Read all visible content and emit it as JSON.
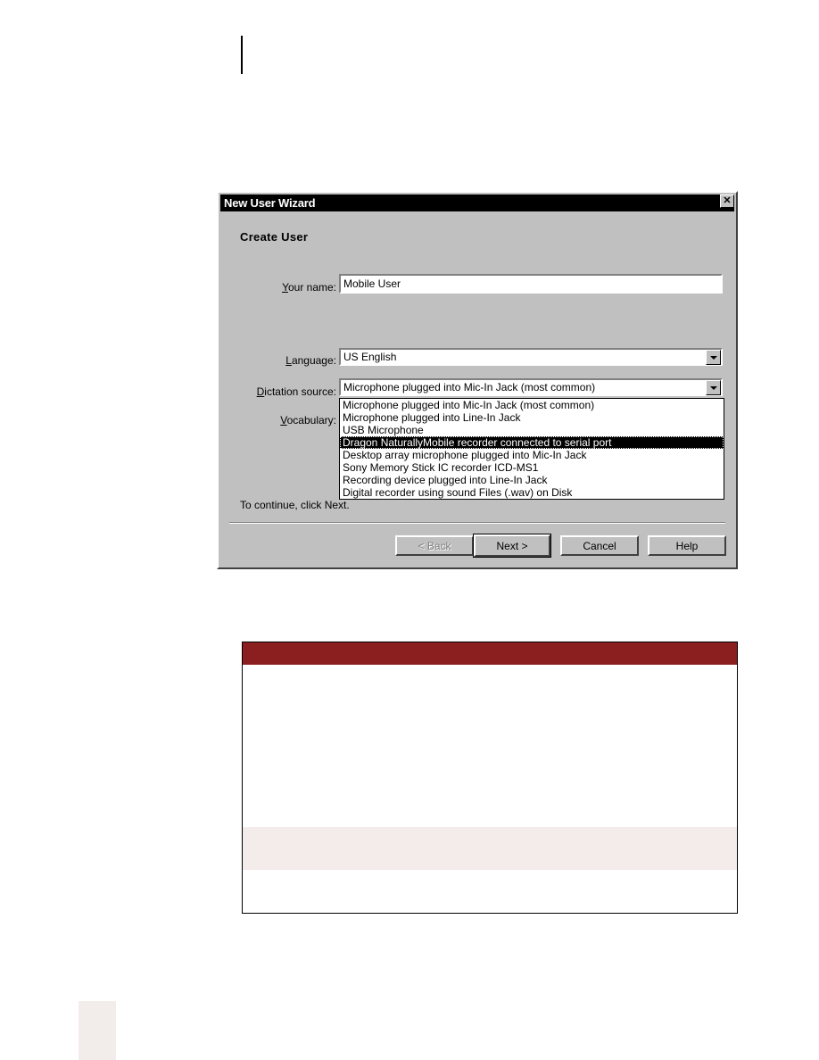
{
  "page": {
    "background_color": "#ffffff",
    "rule_color": "#000000",
    "corner_block_color": "#f2eceb"
  },
  "dialog": {
    "title": "New User Wizard",
    "close_label": "✕",
    "heading": "Create User",
    "fields": {
      "name": {
        "label": "Your name:",
        "label_accesskey": "Y",
        "value": "Mobile User"
      },
      "language": {
        "label": "Language:",
        "label_accesskey": "L",
        "value": "US English"
      },
      "dictation_source": {
        "label": "Dictation source:",
        "label_accesskey": "D",
        "value": "Microphone plugged into Mic-In Jack (most common)",
        "expanded": true,
        "options": [
          "Microphone plugged into Mic-In Jack (most common)",
          "Microphone plugged into Line-In Jack",
          "USB Microphone",
          "Dragon NaturallyMobile recorder connected to serial port",
          "Desktop array microphone plugged into Mic-In Jack",
          "Sony Memory Stick IC recorder ICD-MS1",
          "Recording device plugged into Line-In Jack",
          "Digital recorder using sound Files (.wav) on Disk"
        ],
        "selected_index": 3
      },
      "vocabulary": {
        "label": "Vocabulary:",
        "label_accesskey": "V"
      }
    },
    "hint": "To continue, click Next.",
    "buttons": [
      {
        "label": "< Back",
        "accesskey": "B",
        "state": "disabled",
        "name": "back-button"
      },
      {
        "label": "Next >",
        "accesskey": "N",
        "state": "default",
        "name": "next-button"
      },
      {
        "label": "Cancel",
        "accesskey": "",
        "state": "normal",
        "name": "cancel-button"
      },
      {
        "label": "Help",
        "accesskey": "",
        "state": "normal",
        "name": "help-button"
      }
    ]
  },
  "note_box": {
    "header_color": "#8b1e1e",
    "band_color": "#f4ecea",
    "border_color": "#000000"
  }
}
